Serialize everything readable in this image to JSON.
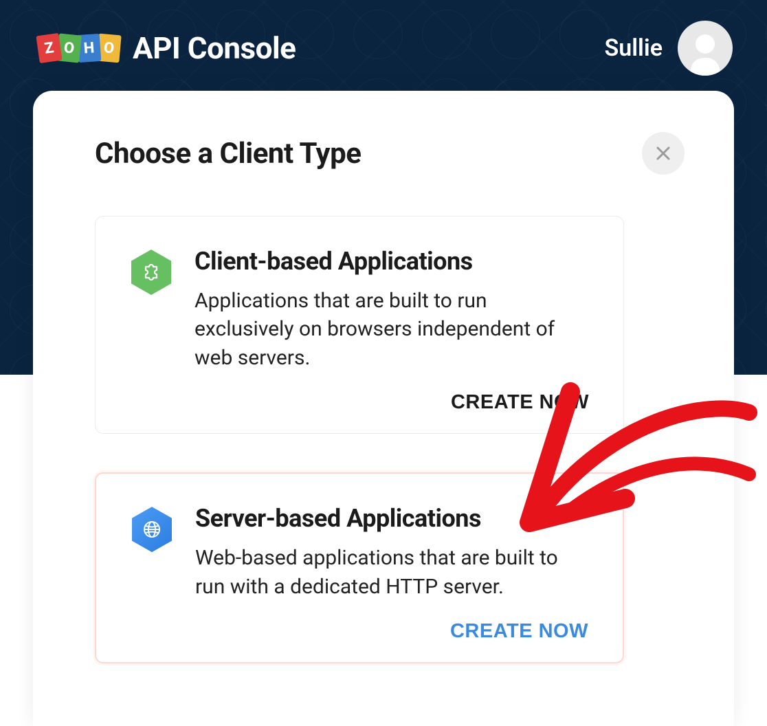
{
  "header": {
    "brand_title": "API Console",
    "user_name": "Sullie"
  },
  "panel": {
    "title": "Choose a Client Type"
  },
  "cards": [
    {
      "title": "Client-based Applications",
      "description": "Applications that are built to run exclusively on browsers independent of web servers.",
      "action_label": "CREATE NOW"
    },
    {
      "title": "Server-based Applications",
      "description": "Web-based applications that are built to run with a dedicated HTTP server.",
      "action_label": "CREATE NOW"
    }
  ],
  "logo": {
    "z": "Z",
    "o1": "O",
    "h": "H",
    "o2": "O"
  }
}
